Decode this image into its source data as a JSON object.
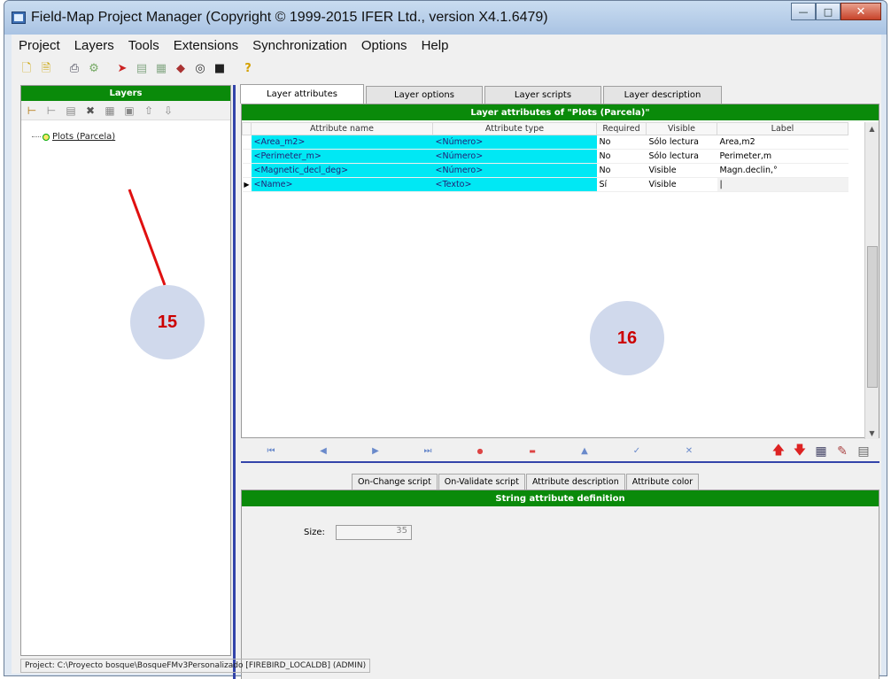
{
  "window": {
    "title": "Field-Map Project Manager (Copyright © 1999-2015 IFER Ltd., version X4.1.6479)"
  },
  "menu": [
    "Project",
    "Layers",
    "Tools",
    "Extensions",
    "Synchronization",
    "Options",
    "Help"
  ],
  "toolbar_icons": [
    "new-project-icon",
    "open-project-icon",
    "print-icon",
    "settings-icon",
    "import-icon",
    "layer-copy-icon",
    "layer-paste-icon",
    "database-icon",
    "target-icon",
    "export-icon",
    "help-icon"
  ],
  "left_panel": {
    "header": "Layers",
    "tree": [
      {
        "label": "Plots (Parcela)"
      }
    ]
  },
  "tabs": [
    "Layer attributes",
    "Layer options",
    "Layer scripts",
    "Layer description"
  ],
  "attributes": {
    "title": "Layer attributes of \"Plots (Parcela)\"",
    "columns": [
      "Attribute name",
      "Attribute type",
      "Required",
      "Visible",
      "Label"
    ],
    "rows": [
      {
        "name": "<Area_m2>",
        "type": "<Número>",
        "required": "No",
        "visible": "Sólo lectura",
        "label": "Area,m2"
      },
      {
        "name": "<Perimeter_m>",
        "type": "<Número>",
        "required": "No",
        "visible": "Sólo lectura",
        "label": "Perimeter,m"
      },
      {
        "name": "<Magnetic_decl_deg>",
        "type": "<Número>",
        "required": "No",
        "visible": "Visible",
        "label": "Magn.declin,°"
      },
      {
        "name": "<Name>",
        "type": "<Texto>",
        "required": "Sí",
        "visible": "Visible",
        "label": "|"
      }
    ]
  },
  "subtabs": [
    "On-Change script",
    "On-Validate script",
    "Attribute description",
    "Attribute color"
  ],
  "definition": {
    "title": "String attribute definition",
    "size_label": "Size:",
    "size_value": "35"
  },
  "statusbar": {
    "text": "Project: C:\\Proyecto bosque\\BosqueFMv3Personalizado [FIREBIRD_LOCALDB] (ADMIN)"
  },
  "callouts": [
    "15",
    "16"
  ],
  "colors": {
    "header_green": "#0a8a0a",
    "selection_cyan": "#00e8f4",
    "splitter_blue": "#3344aa",
    "callout_fill": "#d0d9ec",
    "callout_text": "#cc0000"
  }
}
